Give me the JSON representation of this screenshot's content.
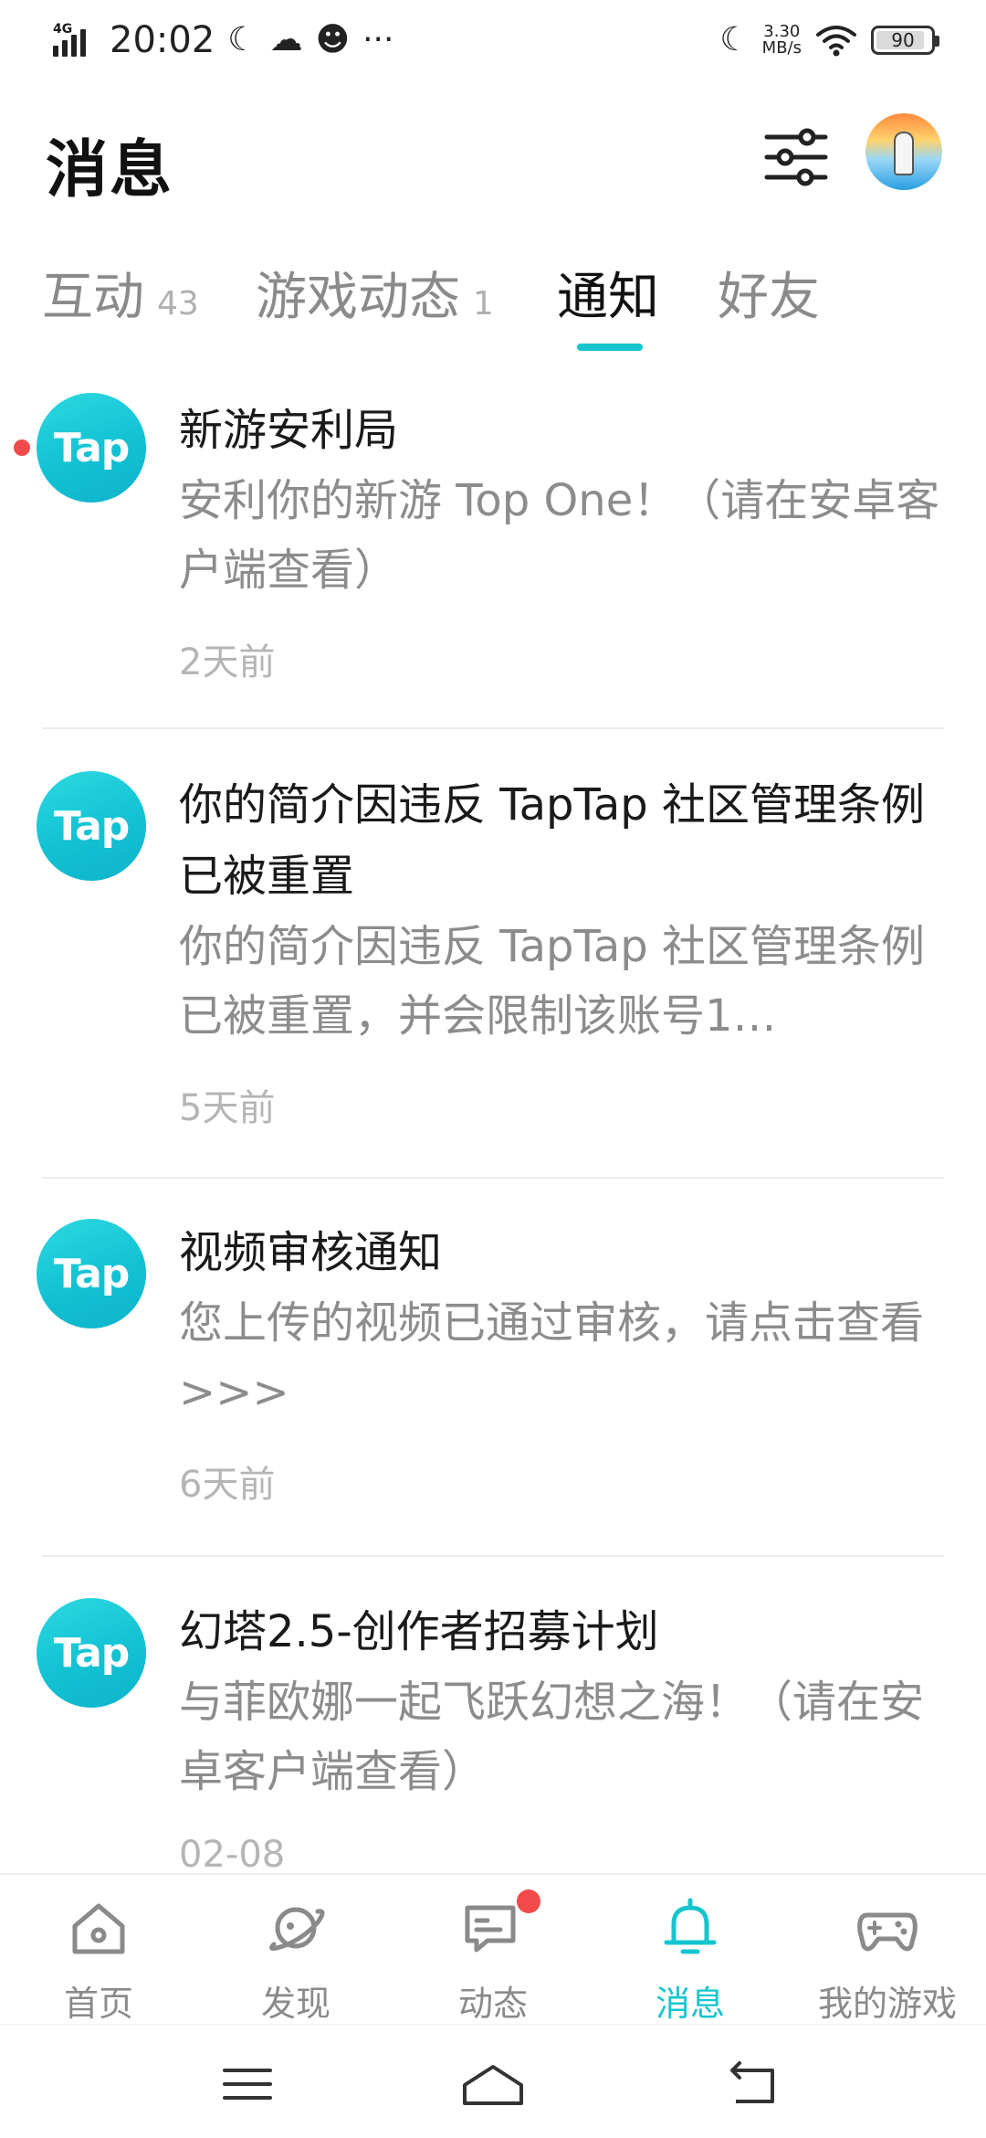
{
  "status_bar": {
    "network": "4G",
    "time": "20:02",
    "speed_value": "3.30",
    "speed_unit": "MB/s",
    "battery": "90",
    "battery_level": 0.9,
    "extra": "···"
  },
  "header": {
    "title": "消息"
  },
  "tabs": [
    {
      "label": "互动",
      "count": "43"
    },
    {
      "label": "游戏动态",
      "count": "1"
    },
    {
      "label": "通知",
      "count": ""
    },
    {
      "label": "好友",
      "count": ""
    }
  ],
  "active_tab": "通知",
  "accent_color": "#15c5ce",
  "notifications": [
    {
      "logo": "Tap",
      "title": "新游安利局",
      "body": "安利你的新游 Top One！（请在安卓客户端查看）",
      "time": "2天前",
      "unread": true
    },
    {
      "logo": "Tap",
      "title": "你的简介因违反 TapTap 社区管理条例已被重置",
      "body": "你的简介因违反 TapTap 社区管理条例已被重置，并会限制该账号1…",
      "time": "5天前",
      "unread": false
    },
    {
      "logo": "Tap",
      "title": "视频审核通知",
      "body": "您上传的视频已通过审核，请点击查看>>>",
      "time": "6天前",
      "unread": false
    },
    {
      "logo": "Tap",
      "title": "幻塔2.5-创作者招募计划",
      "body": "与菲欧娜一起飞跃幻想之海！（请在安卓客户端查看）",
      "time": "02-08",
      "unread": false
    }
  ],
  "bottom_nav": [
    {
      "label": "首页",
      "icon": "home-icon"
    },
    {
      "label": "发现",
      "icon": "planet-icon"
    },
    {
      "label": "动态",
      "icon": "chat-icon",
      "badge": true
    },
    {
      "label": "消息",
      "icon": "bell-icon",
      "active": true
    },
    {
      "label": "我的游戏",
      "icon": "gamepad-icon"
    }
  ]
}
